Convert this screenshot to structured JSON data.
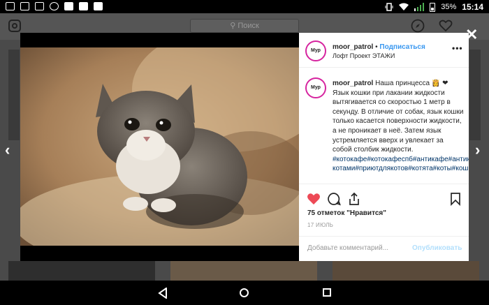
{
  "status_bar": {
    "time": "15:14",
    "battery": "35%"
  },
  "header": {
    "search_placeholder": "Поиск"
  },
  "post": {
    "username": "moor_patrol",
    "separator": "•",
    "follow_label": "Подписаться",
    "location": "Лофт Проект ЭТАЖИ",
    "avatar_text": "Мур",
    "more_label": "•••",
    "caption_username": "moor_patrol",
    "caption_text": "Наша принцесса 👸 ❤ Язык кошки при лакании жидкости вытягивается со скоростью 1 метр в секунду. В отличие от собак, язык кошки только касается поверхности жидкости, а не проникает в неё. Затем язык устремляется вверх и увлекает за собой столбик жидкости.",
    "hashtags": "#котокафе#котокафеспб#антикафе#антикафеспб#антикафеспб#антикафес котами#приютдлякотов#котята#коты#кошки",
    "likes": "75 отметок \"Нравится\"",
    "date": "17 ИЮЛЬ",
    "comment_placeholder": "Добавьте комментарий...",
    "publish_label": "Опубликовать"
  },
  "colors": {
    "accent": "#3897f0",
    "like": "#ed4956",
    "avatar_ring": "#d6249f"
  },
  "icons": [
    "instagram-logo-icon",
    "search-icon",
    "compass-icon",
    "heart-icon",
    "user-icon",
    "close-icon",
    "chevron-left-icon",
    "chevron-right-icon",
    "like-heart-icon",
    "comment-icon",
    "share-icon",
    "bookmark-icon",
    "nav-back-icon",
    "nav-home-icon",
    "nav-recents-icon"
  ]
}
